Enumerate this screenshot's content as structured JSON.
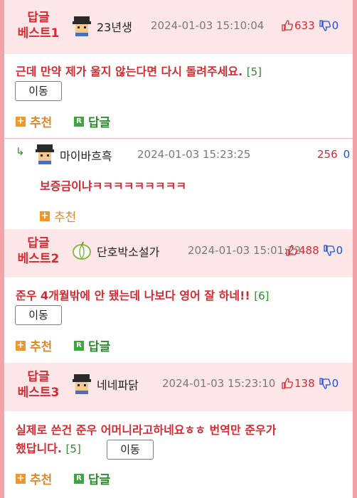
{
  "comments": [
    {
      "best_line1": "답글",
      "best_line2": "베스트1",
      "nickname": "23년생",
      "time": "2024-01-03  15:10:04",
      "up": "633",
      "down": "0",
      "text": "근데 만약 제가 울지 않는다면 다시 돌려주세요.",
      "reply_count": "[5]",
      "move_label": "이동",
      "recommend_label": "추천",
      "reply_label": "답글",
      "avatar_icon": "pixel-character-icon"
    },
    {
      "nickname": "마이바흐흑",
      "time": "2024-01-03  15:23:25",
      "up": "256",
      "down": "0",
      "text": "보증금이냐ㅋㅋㅋㅋㅋㅋㅋㅋㅋ",
      "recommend_label": "추천",
      "avatar_icon": "pixel-character-icon",
      "reply_arrow_icon": "reply-arrow-icon"
    },
    {
      "best_line1": "답글",
      "best_line2": "베스트2",
      "nickname": "단호박소설가",
      "time": "2024-01-03  15:01:22",
      "up": "488",
      "down": "0",
      "text": "준우 4개월밖에 안 됐는데 나보다 영어 잘 하네!!",
      "reply_count": "[6]",
      "move_label": "이동",
      "recommend_label": "추천",
      "reply_label": "답글",
      "avatar_icon": "pumpkin-icon"
    },
    {
      "best_line1": "답글",
      "best_line2": "베스트3",
      "nickname": "네네파닭",
      "time": "2024-01-03  15:23:10",
      "up": "138",
      "down": "0",
      "text_line1": "실제로 쓴건 준우 어머니라고하네요ㅎㅎ 번역만 준우가",
      "text_line2": "했답니다.",
      "reply_count": "[5]",
      "move_label": "이동",
      "recommend_label": "추천",
      "reply_label": "답글",
      "avatar_icon": "pixel-character-icon"
    }
  ],
  "colors": {
    "accent_red": "#d62a30",
    "border_pink": "#f2a2a8",
    "best_bg": "#fde6e8",
    "down_blue": "#1f4fcf",
    "reply_green": "#2e8b2e",
    "recommend_orange": "#e0892a"
  },
  "icons": {
    "thumb_up": "thumbs-up-icon",
    "thumb_down": "thumbs-down-icon",
    "plus": "plus-box-icon",
    "reply_badge": "r-badge-icon"
  }
}
